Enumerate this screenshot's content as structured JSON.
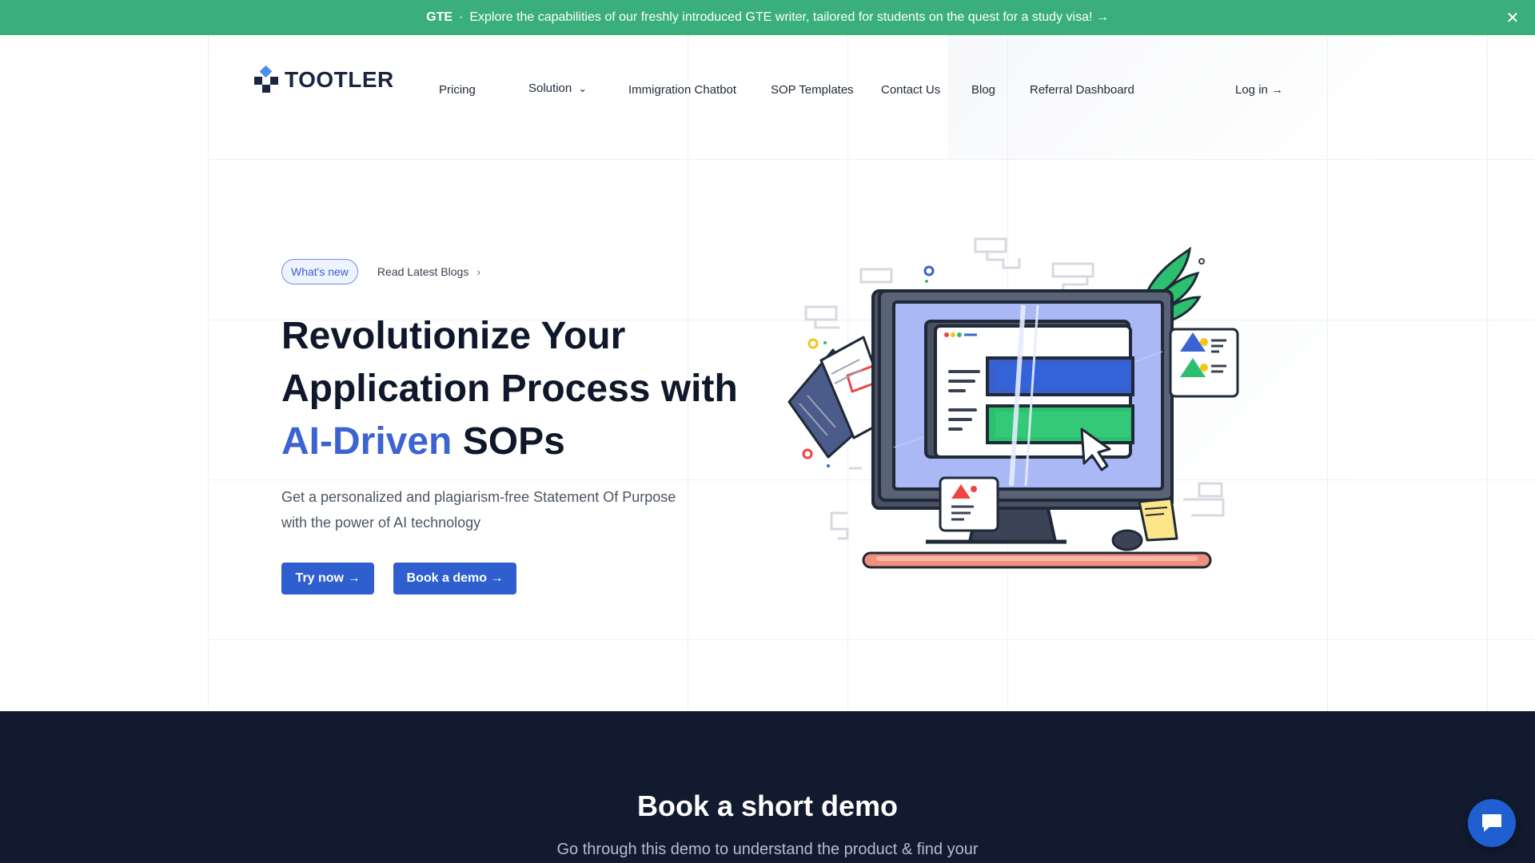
{
  "banner": {
    "tag": "GTE",
    "separator": "·",
    "message": "Explore the capabilities of our freshly introduced GTE writer, tailored for students on the quest for a study visa! →",
    "close_icon": "close-icon"
  },
  "header": {
    "logo_text": "TOOTLER",
    "nav": {
      "pricing": "Pricing",
      "solution": "Solution",
      "chatbot": "Immigration Chatbot",
      "templates": "SOP Templates",
      "contact": "Contact Us",
      "blog": "Blog",
      "referral": "Referral Dashboard",
      "login": "Log in →"
    }
  },
  "hero": {
    "pill": "What's new",
    "blog_link": "Read Latest Blogs",
    "headline_line1": "Revolutionize Your",
    "headline_line2": "Application Process with",
    "headline_accent": "AI-Driven",
    "headline_end": " SOPs",
    "subtitle": "Get a personalized and plagiarism-free Statement Of Purpose with the power of AI technology",
    "try_button": "Try now →",
    "demo_button": "Book a demo →"
  },
  "demo_section": {
    "title": "Book a short demo",
    "subtitle": "Go through this demo to understand the product & find your"
  },
  "colors": {
    "banner": "#3aaf7c",
    "primary": "#2f5fcf",
    "accent": "#3b63d1",
    "dark": "#111a2e"
  },
  "icons": {
    "chat": "chat-bubble-icon",
    "chevron": "chevron-down-icon",
    "arrow": "chevron-right-icon"
  }
}
